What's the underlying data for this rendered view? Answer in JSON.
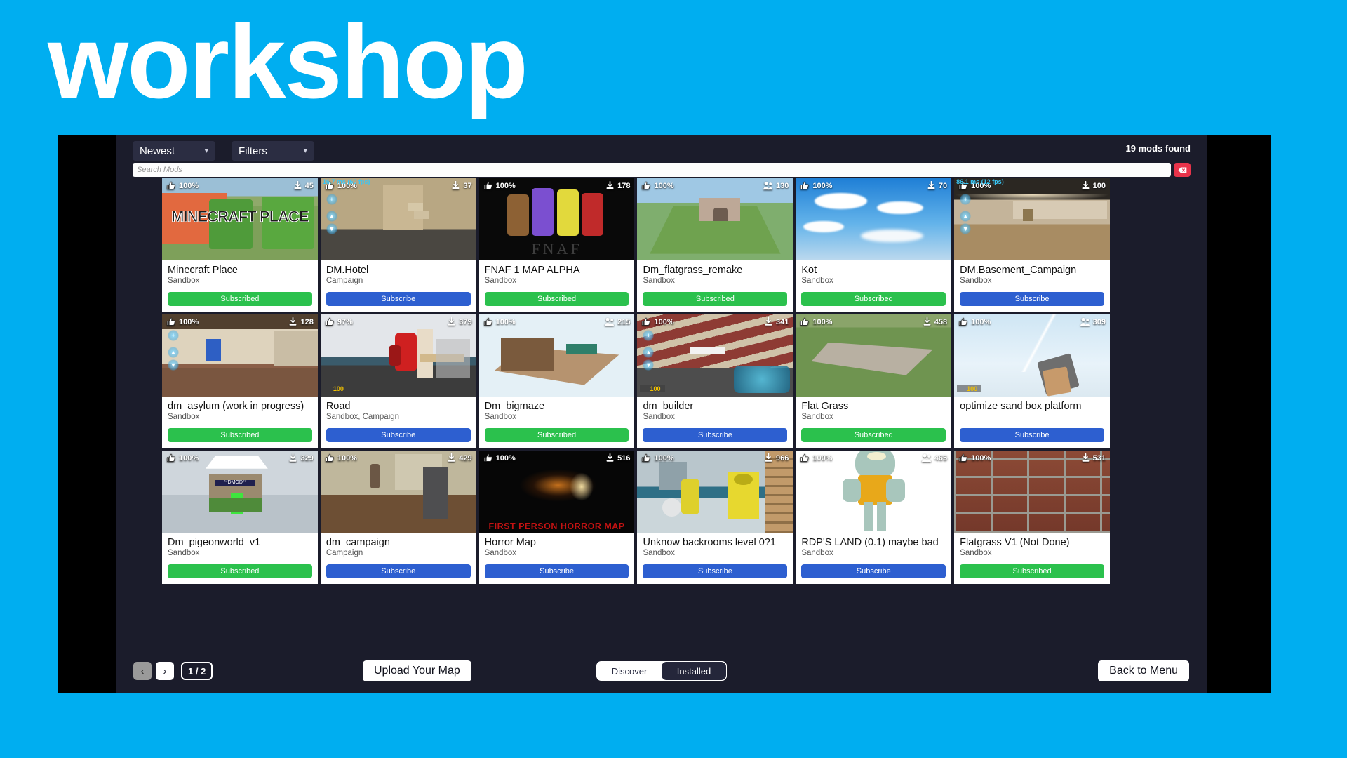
{
  "wordmark": "workshop",
  "colors": {
    "background": "#00AEF0",
    "panel": "#1b1c2b",
    "letterbox": "#000000",
    "subscribed": "#2bc14d",
    "subscribe": "#2d5fd0",
    "clear_button": "#e8334a"
  },
  "topbar": {
    "sort_label": "Newest",
    "filters_label": "Filters",
    "caret_icon": "chevron-down-icon",
    "mods_found": "19 mods found",
    "search_placeholder": "Search Mods",
    "search_value": "",
    "clear_label": "x"
  },
  "cards": [
    {
      "title": "Minecraft Place",
      "category": "Sandbox",
      "rating": "100%",
      "count": "45",
      "count_icon": "download-icon",
      "button": "Subscribed",
      "state": "subscribed",
      "art": "minecraft",
      "fps": ""
    },
    {
      "title": "DM.Hotel",
      "category": "Campaign",
      "rating": "100%",
      "count": "37",
      "count_icon": "download-icon",
      "button": "Subscribe",
      "state": "subscribe",
      "art": "hotel",
      "fps": "16.7 ms (60 fps)"
    },
    {
      "title": "FNAF 1 MAP ALPHA",
      "category": "Sandbox",
      "rating": "100%",
      "count": "178",
      "count_icon": "download-icon",
      "button": "Subscribed",
      "state": "subscribed",
      "art": "fnaf",
      "fps": ""
    },
    {
      "title": "Dm_flatgrass_remake",
      "category": "Sandbox",
      "rating": "100%",
      "count": "130",
      "count_icon": "players-icon",
      "button": "Subscribed",
      "state": "subscribed",
      "art": "flatgrass",
      "fps": ""
    },
    {
      "title": "Kot",
      "category": "Sandbox",
      "rating": "100%",
      "count": "70",
      "count_icon": "download-icon",
      "button": "Subscribed",
      "state": "subscribed",
      "art": "clouds",
      "fps": ""
    },
    {
      "title": "DM.Basement_Campaign",
      "category": "Sandbox",
      "rating": "100%",
      "count": "100",
      "count_icon": "download-icon",
      "button": "Subscribe",
      "state": "subscribe",
      "art": "basement",
      "fps": "86.1 ms (12 fps)"
    },
    {
      "title": "dm_asylum (work in progress)",
      "category": "Sandbox",
      "rating": "100%",
      "count": "128",
      "count_icon": "download-icon",
      "button": "Subscribed",
      "state": "subscribed",
      "art": "asylum",
      "fps": ""
    },
    {
      "title": "Road",
      "category": "Sandbox, Campaign",
      "rating": "97%",
      "count": "379",
      "count_icon": "download-icon",
      "button": "Subscribe",
      "state": "subscribe",
      "art": "road",
      "fps": ""
    },
    {
      "title": "Dm_bigmaze",
      "category": "Sandbox",
      "rating": "100%",
      "count": "215",
      "count_icon": "players-icon",
      "button": "Subscribed",
      "state": "subscribed",
      "art": "bigmaze",
      "fps": ""
    },
    {
      "title": "dm_builder",
      "category": "Sandbox",
      "rating": "100%",
      "count": "341",
      "count_icon": "download-icon",
      "button": "Subscribe",
      "state": "subscribe",
      "art": "builder",
      "fps": ""
    },
    {
      "title": "Flat Grass",
      "category": "Sandbox",
      "rating": "100%",
      "count": "458",
      "count_icon": "download-icon",
      "button": "Subscribed",
      "state": "subscribed",
      "art": "flatgrass2",
      "fps": ""
    },
    {
      "title": "optimize sand box platform",
      "category": "",
      "rating": "100%",
      "count": "309",
      "count_icon": "players-icon",
      "button": "Subscribe",
      "state": "subscribe",
      "art": "sandbox-sky",
      "fps": ""
    },
    {
      "title": "Dm_pigeonworld_v1",
      "category": "Sandbox",
      "rating": "100%",
      "count": "329",
      "count_icon": "download-icon",
      "button": "Subscribed",
      "state": "subscribed",
      "art": "pigeon",
      "fps": ""
    },
    {
      "title": "dm_campaign",
      "category": "Campaign",
      "rating": "100%",
      "count": "429",
      "count_icon": "download-icon",
      "button": "Subscribe",
      "state": "subscribe",
      "art": "campaign",
      "fps": ""
    },
    {
      "title": "Horror Map",
      "category": "Sandbox",
      "rating": "100%",
      "count": "516",
      "count_icon": "download-icon",
      "button": "Subscribe",
      "state": "subscribe",
      "art": "horror",
      "fps": ""
    },
    {
      "title": "Unknow backrooms level 0?1",
      "category": "Sandbox",
      "rating": "100%",
      "count": "966",
      "count_icon": "download-icon",
      "button": "Subscribe",
      "state": "subscribe",
      "art": "backrooms",
      "fps": ""
    },
    {
      "title": "RDP'S LAND (0.1) maybe bad",
      "category": "Sandbox",
      "rating": "100%",
      "count": "465",
      "count_icon": "players-icon",
      "button": "Subscribe",
      "state": "subscribe",
      "art": "squidward",
      "fps": ""
    },
    {
      "title": "Flatgrass V1 (Not Done)",
      "category": "Sandbox",
      "rating": "100%",
      "count": "531",
      "count_icon": "download-icon",
      "button": "Subscribed",
      "state": "subscribed",
      "art": "brick",
      "fps": ""
    }
  ],
  "bottombar": {
    "prev_label": "‹",
    "next_label": "›",
    "page_indicator": "1 / 2",
    "upload_label": "Upload Your Map",
    "discover_label": "Discover",
    "installed_label": "Installed",
    "active_view": "Installed",
    "back_label": "Back to Menu"
  }
}
